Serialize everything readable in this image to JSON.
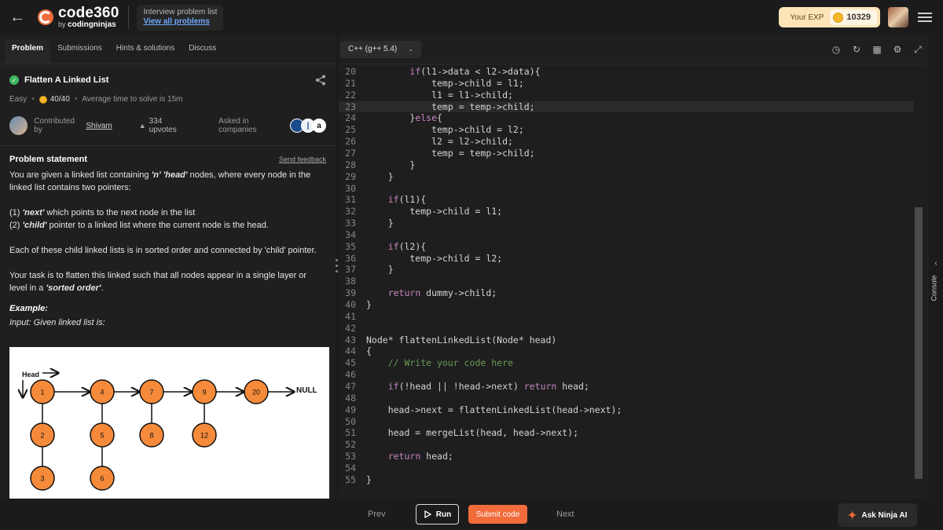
{
  "header": {
    "logo_brand": "code",
    "logo_num": "360",
    "logo_by": "by",
    "logo_company": "codingninjas",
    "crumb_title": "Interview problem list",
    "crumb_link": "View all problems",
    "exp_label": "Your EXP",
    "exp_value": "10329"
  },
  "tabs": [
    {
      "label": "Problem"
    },
    {
      "label": "Submissions"
    },
    {
      "label": "Hints & solutions"
    },
    {
      "label": "Discuss"
    }
  ],
  "problem": {
    "title": "Flatten A Linked List",
    "difficulty": "Easy",
    "score": "40/40",
    "avg_time": "Average time to solve is 15m",
    "contributed_label": "Contributed by",
    "contributor": "Shivam",
    "upvotes": "334 upvotes",
    "asked_label": "Asked in companies",
    "statement_title": "Problem statement",
    "feedback": "Send feedback",
    "p1_a": "You are given a linked list containing ",
    "p1_b": "'n' 'head'",
    "p1_c": " nodes, where every node in the linked list contains two pointers:",
    "p2_a": "(1) ",
    "p2_b": "'next'",
    "p2_c": " which points to the next node in the list",
    "p2_d": "(2) ",
    "p2_e": "'child'",
    "p2_f": " pointer to a linked list where the current node is the head.",
    "p3": "Each of these child linked lists is in sorted order and connected by 'child' pointer.",
    "p4_a": "Your task is to flatten this linked such that all nodes appear in a single layer or level in a ",
    "p4_b": "'sorted order'",
    "p4_c": ".",
    "example_title": "Example:",
    "example_input": "Input: Given linked list is:"
  },
  "diagram": {
    "head_label": "Head",
    "null_label": "NULL",
    "main_nodes": [
      "1",
      "4",
      "7",
      "9",
      "20"
    ],
    "child_nodes": [
      [
        "2",
        "3"
      ],
      [
        "5",
        "6"
      ],
      [
        "8"
      ],
      [
        "12"
      ],
      []
    ],
    "node_color": "#f58a3a"
  },
  "editor": {
    "language": "C++ (g++ 5.4)",
    "lines": [
      {
        "n": "20",
        "t": "        if(l1->data < l2->data){"
      },
      {
        "n": "21",
        "t": "            temp->child = l1;"
      },
      {
        "n": "22",
        "t": "            l1 = l1->child;"
      },
      {
        "n": "23",
        "t": "            temp = temp->child;",
        "cur": true
      },
      {
        "n": "24",
        "t": "        }else{"
      },
      {
        "n": "25",
        "t": "            temp->child = l2;"
      },
      {
        "n": "26",
        "t": "            l2 = l2->child;"
      },
      {
        "n": "27",
        "t": "            temp = temp->child;"
      },
      {
        "n": "28",
        "t": "        }"
      },
      {
        "n": "29",
        "t": "    }"
      },
      {
        "n": "30",
        "t": ""
      },
      {
        "n": "31",
        "t": "    if(l1){"
      },
      {
        "n": "32",
        "t": "        temp->child = l1;"
      },
      {
        "n": "33",
        "t": "    }"
      },
      {
        "n": "34",
        "t": ""
      },
      {
        "n": "35",
        "t": "    if(l2){"
      },
      {
        "n": "36",
        "t": "        temp->child = l2;"
      },
      {
        "n": "37",
        "t": "    }"
      },
      {
        "n": "38",
        "t": ""
      },
      {
        "n": "39",
        "t": "    return dummy->child;"
      },
      {
        "n": "40",
        "t": "}"
      },
      {
        "n": "41",
        "t": ""
      },
      {
        "n": "42",
        "t": ""
      },
      {
        "n": "43",
        "t": "Node* flattenLinkedList(Node* head)"
      },
      {
        "n": "44",
        "t": "{"
      },
      {
        "n": "45",
        "t": "    // Write your code here"
      },
      {
        "n": "46",
        "t": ""
      },
      {
        "n": "47",
        "t": "    if(!head || !head->next) return head;"
      },
      {
        "n": "48",
        "t": ""
      },
      {
        "n": "49",
        "t": "    head->next = flattenLinkedList(head->next);"
      },
      {
        "n": "50",
        "t": ""
      },
      {
        "n": "51",
        "t": "    head = mergeList(head, head->next);"
      },
      {
        "n": "52",
        "t": ""
      },
      {
        "n": "53",
        "t": "    return head;"
      },
      {
        "n": "54",
        "t": ""
      },
      {
        "n": "55",
        "t": "}"
      }
    ],
    "console_label": "Console"
  },
  "footer": {
    "prev": "Prev",
    "run": "Run",
    "submit": "Submit code",
    "next": "Next",
    "ninja": "Ask Ninja AI"
  },
  "colors": {
    "accent": "#f26b3a",
    "success": "#3db860",
    "link": "#6fa8ff"
  }
}
